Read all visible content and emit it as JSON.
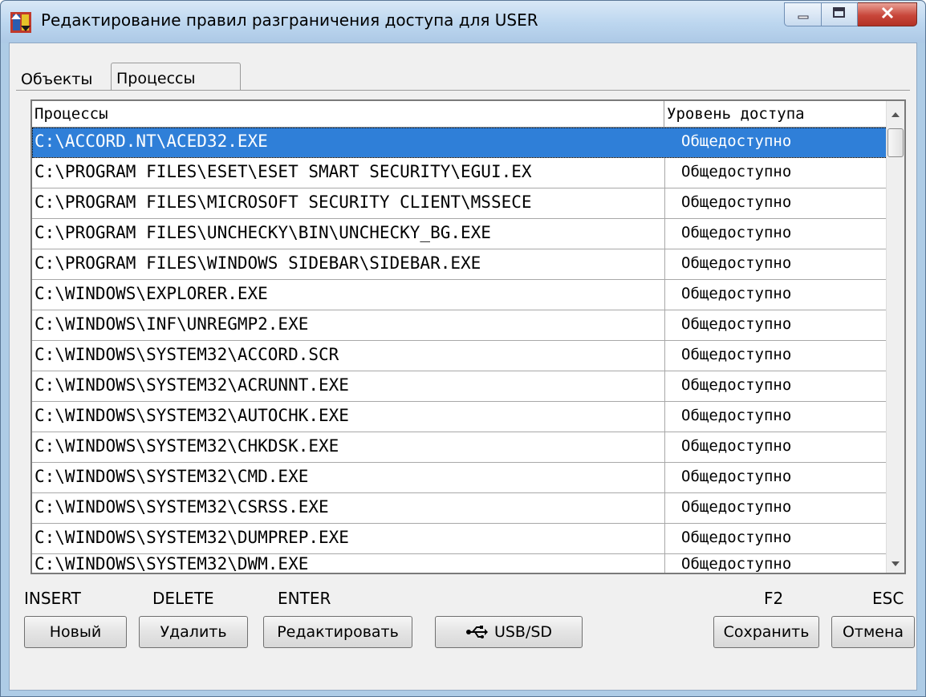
{
  "window": {
    "title": "Редактирование правил разграничения доступа для USER"
  },
  "tabs": [
    {
      "label": "Объекты",
      "active": false
    },
    {
      "label": "Процессы",
      "active": true
    }
  ],
  "table": {
    "columns": [
      "Процессы",
      "Уровень доступа"
    ],
    "rows": [
      {
        "process": "C:\\ACCORD.NT\\ACED32.EXE",
        "access": "Общедоступно",
        "selected": true
      },
      {
        "process": "C:\\PROGRAM FILES\\ESET\\ESET SMART SECURITY\\EGUI.EX",
        "access": "Общедоступно"
      },
      {
        "process": "C:\\PROGRAM FILES\\MICROSOFT SECURITY CLIENT\\MSSECE",
        "access": "Общедоступно"
      },
      {
        "process": "C:\\PROGRAM FILES\\UNCHECKY\\BIN\\UNCHECKY_BG.EXE",
        "access": "Общедоступно"
      },
      {
        "process": "C:\\PROGRAM FILES\\WINDOWS SIDEBAR\\SIDEBAR.EXE",
        "access": "Общедоступно"
      },
      {
        "process": "C:\\WINDOWS\\EXPLORER.EXE",
        "access": "Общедоступно"
      },
      {
        "process": "C:\\WINDOWS\\INF\\UNREGMP2.EXE",
        "access": "Общедоступно"
      },
      {
        "process": "C:\\WINDOWS\\SYSTEM32\\ACCORD.SCR",
        "access": "Общедоступно"
      },
      {
        "process": "C:\\WINDOWS\\SYSTEM32\\ACRUNNT.EXE",
        "access": "Общедоступно"
      },
      {
        "process": "C:\\WINDOWS\\SYSTEM32\\AUTOCHK.EXE",
        "access": "Общедоступно"
      },
      {
        "process": "C:\\WINDOWS\\SYSTEM32\\CHKDSK.EXE",
        "access": "Общедоступно"
      },
      {
        "process": "C:\\WINDOWS\\SYSTEM32\\CMD.EXE",
        "access": "Общедоступно"
      },
      {
        "process": "C:\\WINDOWS\\SYSTEM32\\CSRSS.EXE",
        "access": "Общедоступно"
      },
      {
        "process": "C:\\WINDOWS\\SYSTEM32\\DUMPREP.EXE",
        "access": "Общедоступно"
      },
      {
        "process": "C:\\WINDOWS\\SYSTEM32\\DWM.EXE",
        "access": "Общедоступно",
        "partial": true
      }
    ]
  },
  "shortcuts": {
    "insert": "INSERT",
    "delete": "DELETE",
    "enter": "ENTER",
    "save": "F2",
    "cancel": "ESC"
  },
  "buttons": {
    "new": "Новый",
    "delete": "Удалить",
    "edit": "Редактировать",
    "usb": "USB/SD",
    "save": "Сохранить",
    "cancel": "Отмена"
  },
  "colors": {
    "selection": "#2f7fd8",
    "title_bar": "#bcd6ef",
    "close_button": "#c8463a"
  },
  "icons": {
    "app": "accord-app-icon",
    "usb": "usb-icon",
    "minimize": "minimize-icon",
    "maximize": "maximize-icon",
    "close": "close-icon"
  }
}
